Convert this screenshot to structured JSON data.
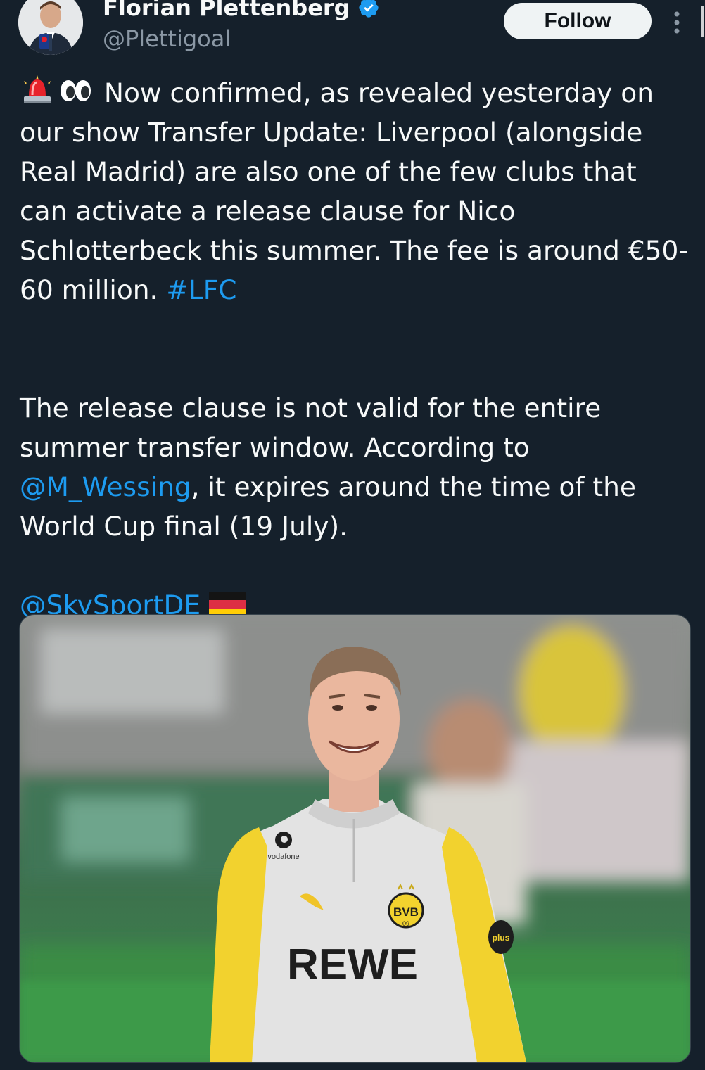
{
  "author": {
    "name": "Florian Plettenberg",
    "handle": "@Plettigoal",
    "verified": true,
    "avatar_icon": "profile-photo"
  },
  "actions": {
    "follow_label": "Follow",
    "more_icon": "vertical-ellipsis-icon"
  },
  "tweet": {
    "lead_emojis": [
      "rotating-light-emoji",
      "eyes-emoji"
    ],
    "p1_text": "Now confirmed, as revealed yesterday on our show Transfer Update: Liverpool (alongside Real Madrid) are also one of the few clubs that can activate a release clause for Nico Schlotterbeck this summer. The fee is around €50-60 million.",
    "p1_hashtag": "#LFC",
    "p2_before": "The release clause is not valid for the entire summer transfer window. According to",
    "p2_mention": "@M_Wessing",
    "p2_after": ", it expires around the time of the World Cup final (19 July).",
    "p3_mention": "@SkySportDE",
    "p3_flag": "germany-flag-emoji"
  },
  "media": {
    "kit_sponsor": "vodafone",
    "shirt_sponsor": "REWE",
    "badge_text": "BVB",
    "badge_year": "09",
    "sleeve_text": "plus"
  },
  "colors": {
    "background": "#15202b",
    "text": "#f7f9f9",
    "secondary_text": "#8b98a5",
    "link": "#1d9bf0",
    "follow_bg": "#eff3f4",
    "verified": "#1d9bf0"
  }
}
